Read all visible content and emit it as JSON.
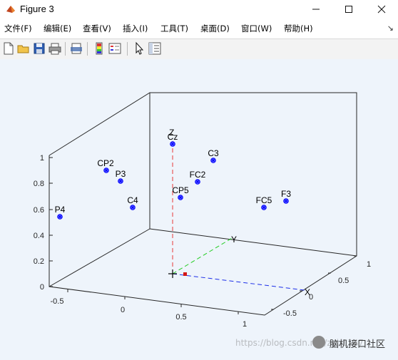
{
  "window": {
    "title": "Figure 3"
  },
  "menu": [
    "文件(F)",
    "编辑(E)",
    "查看(V)",
    "插入(I)",
    "工具(T)",
    "桌面(D)",
    "窗口(W)",
    "帮助(H)"
  ],
  "toolbar": [
    "new-figure-icon",
    "open-icon",
    "save-icon",
    "print-icon",
    "print-preview-icon",
    "colorbar-icon",
    "legend-icon",
    "pointer-icon",
    "property-editor-icon"
  ],
  "chart_data": {
    "type": "scatter3d",
    "title": "",
    "x_ticks": [
      "-0.5",
      "0",
      "0.5",
      "1"
    ],
    "y_ticks": [
      "-0.5",
      "0",
      "0.5",
      "1"
    ],
    "z_ticks": [
      "0",
      "0.2",
      "0.4",
      "0.6",
      "0.8",
      "1"
    ],
    "xlim": [
      -0.7,
      1.1
    ],
    "ylim": [
      -0.7,
      1.1
    ],
    "zlim": [
      0,
      1.1
    ],
    "axis_labels": {
      "x": "X",
      "y": "Y",
      "z": "Z"
    },
    "points": [
      {
        "label": "P4",
        "z": 0.55
      },
      {
        "label": "CP2",
        "z": 0.9
      },
      {
        "label": "P3",
        "z": 0.82
      },
      {
        "label": "C4",
        "z": 0.61
      },
      {
        "label": "Cz",
        "z": 1.0
      },
      {
        "label": "FC2",
        "z": 0.81
      },
      {
        "label": "CP5",
        "z": 0.68
      },
      {
        "label": "C3",
        "z": 0.97
      },
      {
        "label": "FC5",
        "z": 0.61
      },
      {
        "label": "F3",
        "z": 0.66
      }
    ],
    "marker_color": "#0000ff"
  },
  "watermark": {
    "url": "https://blog.csdn.net/zyb1147",
    "brand": "脑机接口社区"
  }
}
